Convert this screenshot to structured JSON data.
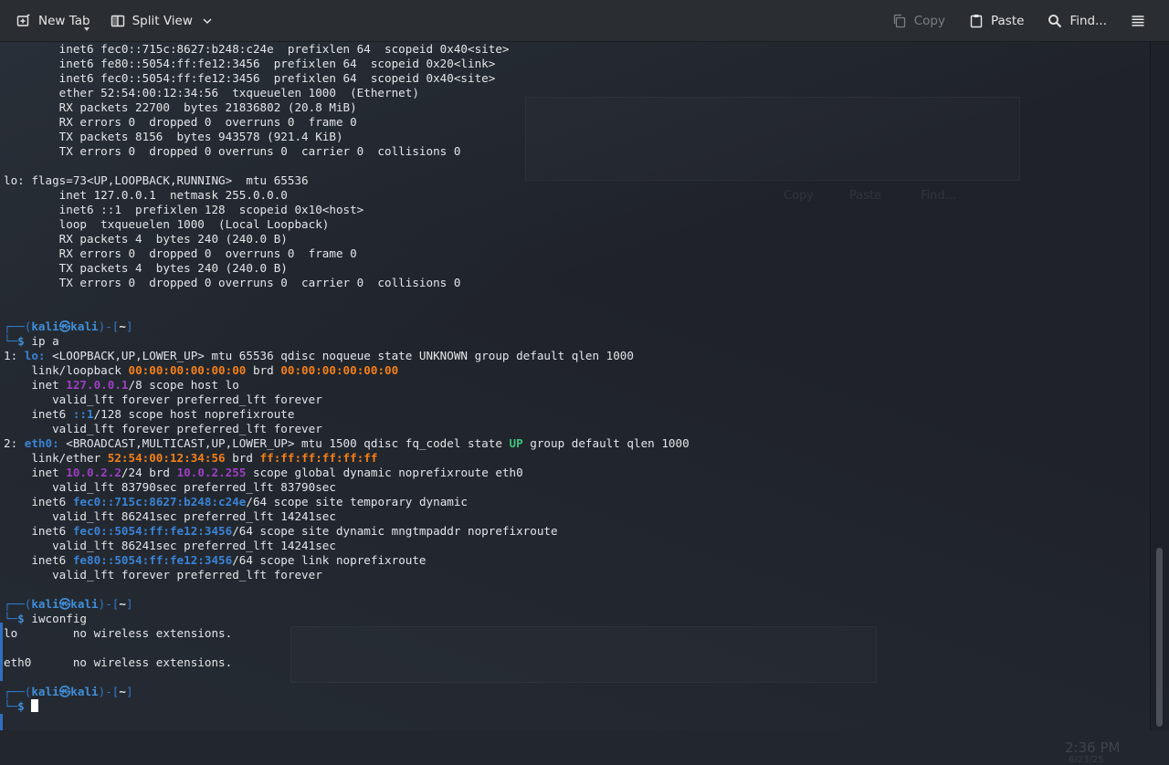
{
  "toolbar": {
    "new_tab": "New Tab",
    "split_view": "Split View",
    "copy": "Copy",
    "paste": "Paste",
    "find": "Find..."
  },
  "colors": {
    "prompt": "#3f8ed8",
    "mac": "#f57f17",
    "ipv4": "#9c3fc2",
    "ipv6": "#3a83d6",
    "state_up": "#3fc07e"
  },
  "prompt": {
    "user": "kali",
    "host": "kali",
    "dir": "~"
  },
  "ifconfig_tail": [
    "        inet6 fec0::715c:8627:b248:c24e  prefixlen 64  scopeid 0x40<site>",
    "        inet6 fe80::5054:ff:fe12:3456  prefixlen 64  scopeid 0x20<link>",
    "        inet6 fec0::5054:ff:fe12:3456  prefixlen 64  scopeid 0x40<site>",
    "        ether 52:54:00:12:34:56  txqueuelen 1000  (Ethernet)",
    "        RX packets 22700  bytes 21836802 (20.8 MiB)",
    "        RX errors 0  dropped 0  overruns 0  frame 0",
    "        TX packets 8156  bytes 943578 (921.4 KiB)",
    "        TX errors 0  dropped 0 overruns 0  carrier 0  collisions 0",
    "",
    "lo: flags=73<UP,LOOPBACK,RUNNING>  mtu 65536",
    "        inet 127.0.0.1  netmask 255.0.0.0",
    "        inet6 ::1  prefixlen 128  scopeid 0x10<host>",
    "        loop  txqueuelen 1000  (Local Loopback)",
    "        RX packets 4  bytes 240 (240.0 B)",
    "        RX errors 0  dropped 0  overruns 0  frame 0",
    "        TX packets 4  bytes 240 (240.0 B)",
    "        TX errors 0  dropped 0 overruns 0  carrier 0  collisions 0",
    "",
    ""
  ],
  "cmd1": "ip a",
  "ip_a": {
    "lo_idx": "1: ",
    "lo_name": "lo:",
    "lo_flags": " <LOOPBACK,UP,LOWER_UP> mtu 65536 qdisc noqueue state UNKNOWN group default qlen 1000",
    "lo_link_pre": "    link/loopback ",
    "lo_mac": "00:00:00:00:00:00",
    "lo_brd": " brd ",
    "lo_brd_mac": "00:00:00:00:00:00",
    "lo_inet_pre": "    inet ",
    "lo_inet": "127.0.0.1",
    "lo_inet_post": "/8 scope host lo",
    "lo_valid1": "       valid_lft forever preferred_lft forever",
    "lo_inet6_pre": "    inet6 ",
    "lo_inet6": "::1",
    "lo_inet6_post": "/128 scope host noprefixroute",
    "lo_valid2": "       valid_lft forever preferred_lft forever",
    "eth_idx": "2: ",
    "eth_name": "eth0:",
    "eth_flags_a": " <BROADCAST,MULTICAST,UP,LOWER_UP> mtu 1500 qdisc fq_codel state ",
    "eth_state": "UP",
    "eth_flags_b": " group default qlen 1000",
    "eth_link_pre": "    link/ether ",
    "eth_mac": "52:54:00:12:34:56",
    "eth_brd": " brd ",
    "eth_brd_mac": "ff:ff:ff:ff:ff:ff",
    "eth_inet_pre": "    inet ",
    "eth_inet": "10.0.2.2",
    "eth_inet_mid": "/24 brd ",
    "eth_inet_brd": "10.0.2.255",
    "eth_inet_post": " scope global dynamic noprefixroute eth0",
    "eth_valid1": "       valid_lft 83790sec preferred_lft 83790sec",
    "eth_inet6a_pre": "    inet6 ",
    "eth_inet6a": "fec0::715c:8627:b248:c24e",
    "eth_inet6a_post": "/64 scope site temporary dynamic",
    "eth_valid2": "       valid_lft 86241sec preferred_lft 14241sec",
    "eth_inet6b_pre": "    inet6 ",
    "eth_inet6b": "fec0::5054:ff:fe12:3456",
    "eth_inet6b_post": "/64 scope site dynamic mngtmpaddr noprefixroute",
    "eth_valid3": "       valid_lft 86241sec preferred_lft 14241sec",
    "eth_inet6c_pre": "    inet6 ",
    "eth_inet6c": "fe80::5054:ff:fe12:3456",
    "eth_inet6c_post": "/64 scope link noprefixroute",
    "eth_valid4": "       valid_lft forever preferred_lft forever"
  },
  "cmd2": "iwconfig",
  "iwconfig": [
    "lo        no wireless extensions.",
    "",
    "eth0      no wireless extensions.",
    "",
    ""
  ],
  "desktop": {
    "clock": "2:36 PM",
    "date": "6/23/25"
  }
}
